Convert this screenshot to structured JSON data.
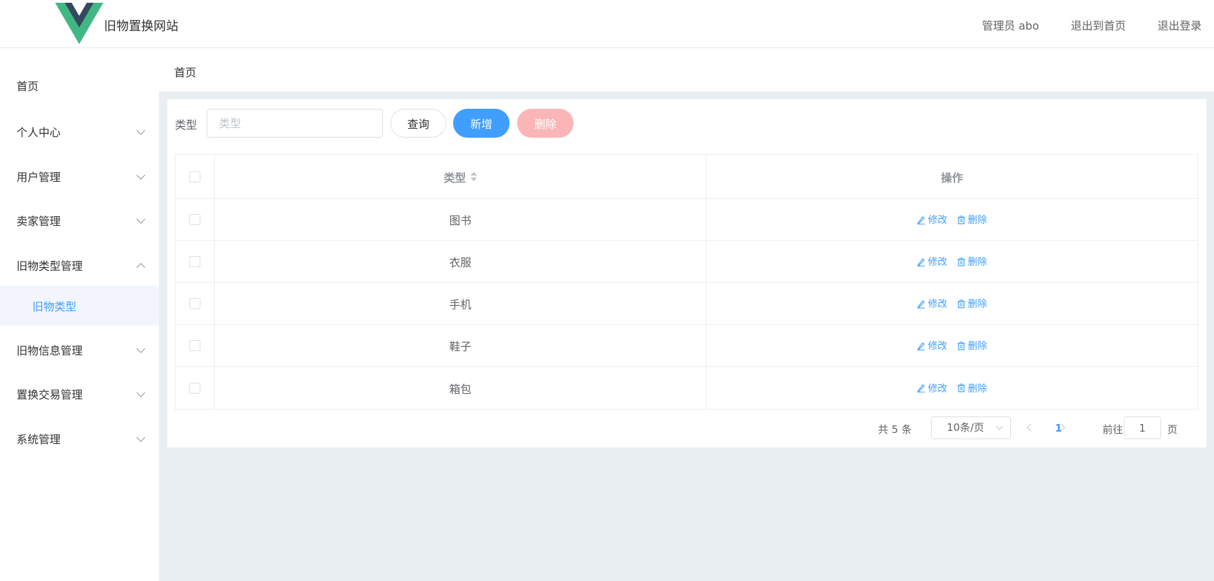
{
  "header": {
    "site_title": "旧物置换网站",
    "links": [
      "管理员 abo",
      "退出到首页",
      "退出登录"
    ]
  },
  "sidebar": {
    "items": [
      {
        "label": "首页"
      },
      {
        "label": "个人中心"
      },
      {
        "label": "用户管理"
      },
      {
        "label": "卖家管理"
      },
      {
        "label": "旧物类型管理"
      },
      {
        "label": "旧物信息管理"
      },
      {
        "label": "置换交易管理"
      },
      {
        "label": "系统管理"
      }
    ],
    "active_sub": "旧物类型"
  },
  "breadcrumb": "首页",
  "search": {
    "label": "类型",
    "placeholder": "类型",
    "value": ""
  },
  "toolbar": {
    "query": "查询",
    "add": "新增",
    "delete": "删除"
  },
  "table": {
    "columns": [
      "类型",
      "操作"
    ],
    "rows": [
      {
        "type": "图书"
      },
      {
        "type": "衣服"
      },
      {
        "type": "手机"
      },
      {
        "type": "鞋子"
      },
      {
        "type": "箱包"
      }
    ],
    "edit_label": "修改",
    "delete_label": "删除"
  },
  "pagination": {
    "total": "共 5 条",
    "page_size": "10条/页",
    "current": "1",
    "goto_label": "前往",
    "goto_value": "1",
    "page_suffix": "页"
  },
  "colors": {
    "primary": "#409eff",
    "danger_light": "#fab6b6",
    "logo_green": "#41b883",
    "logo_dark": "#35495e"
  }
}
